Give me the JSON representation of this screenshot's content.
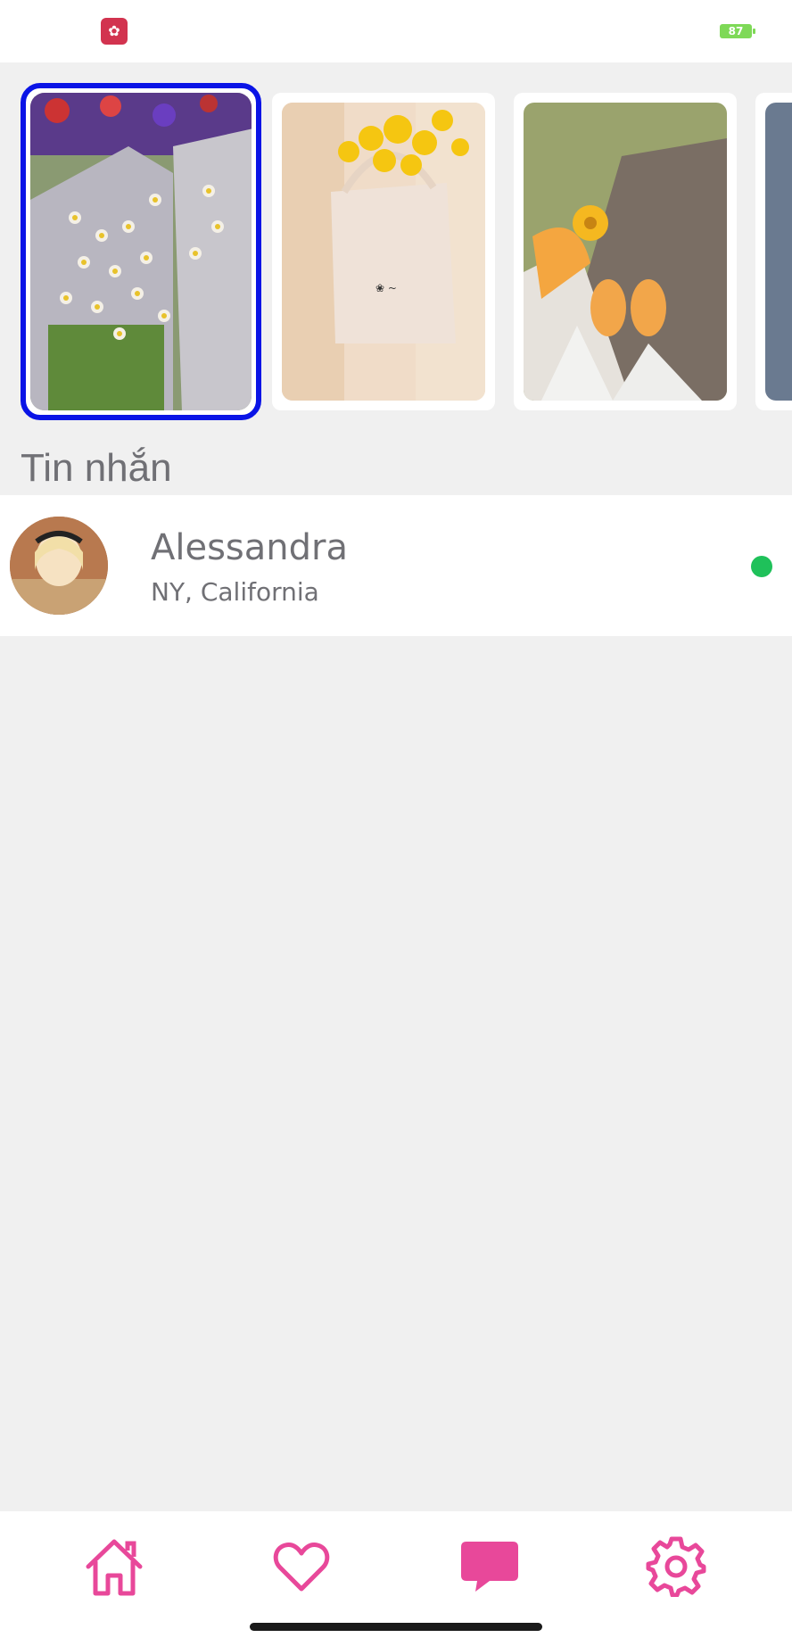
{
  "status_bar": {
    "battery_level": "87",
    "app_icon": "flower-app-icon"
  },
  "stories": [
    {
      "name": "story-flowers-bouquet",
      "selected": true
    },
    {
      "name": "story-yellow-flowers-bag",
      "selected": false
    },
    {
      "name": "story-flower-shoes",
      "selected": false
    }
  ],
  "messages_section": {
    "title": "Tin nhắn"
  },
  "chats": [
    {
      "name": "Alessandra",
      "location": "NY, California",
      "online": true
    }
  ],
  "tabbar": {
    "items": [
      "home-icon",
      "heart-icon",
      "chat-icon",
      "gear-icon"
    ],
    "active": "chat-icon",
    "accent_color": "#e8489a"
  },
  "colors": {
    "selection_border": "#0a14e6",
    "online": "#1fc15a",
    "accent": "#e8489a"
  }
}
